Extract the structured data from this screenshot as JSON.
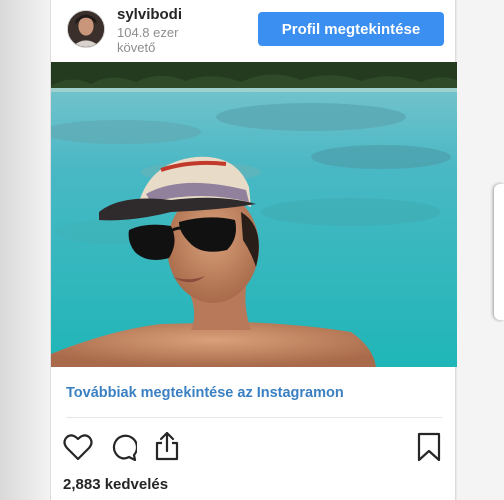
{
  "header": {
    "username": "sylvibodi",
    "followers": "104.8 ezer követő",
    "profile_button": "Profil megtekintése"
  },
  "post": {
    "view_more_link": "Továbbiak megtekintése az Instagramon",
    "likes": "2,883 kedvelés"
  },
  "icons": [
    "avatar",
    "heart-icon",
    "comment-icon",
    "share-icon",
    "bookmark-icon"
  ],
  "colors": {
    "button_blue": "#3b8ff0",
    "link_blue": "#3a80c2",
    "text_dark": "#262626",
    "text_muted": "#8e8e8e"
  }
}
